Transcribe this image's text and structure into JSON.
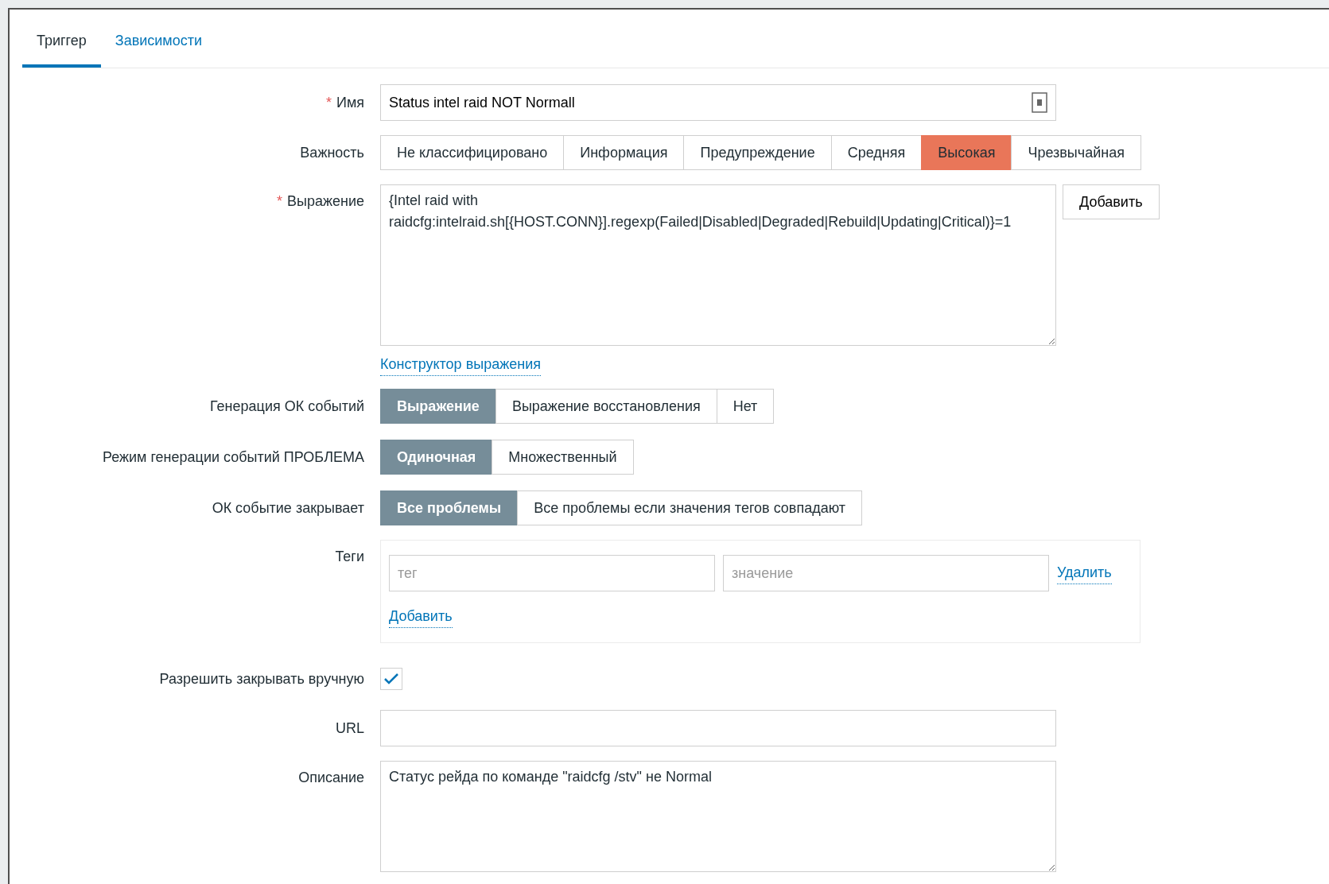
{
  "tabs": [
    {
      "label": "Триггер",
      "selected": true
    },
    {
      "label": "Зависимости",
      "selected": false
    }
  ],
  "name": {
    "label": "Имя",
    "required_mark": "*",
    "value": "Status intel raid NOT Normall"
  },
  "severity": {
    "label": "Важность",
    "options": [
      {
        "label": "Не классифицировано",
        "selected": false
      },
      {
        "label": "Информация",
        "selected": false
      },
      {
        "label": "Предупреждение",
        "selected": false
      },
      {
        "label": "Средняя",
        "selected": false
      },
      {
        "label": "Высокая",
        "selected": true,
        "color": "#e97659"
      },
      {
        "label": "Чрезвычайная",
        "selected": false
      }
    ]
  },
  "expression": {
    "label": "Выражение",
    "required_mark": "*",
    "value": "{Intel raid with raidcfg:intelraid.sh[{HOST.CONN}].regexp(Failed|Disabled|Degraded|Rebuild|Updating|Critical)}=1",
    "add_button": "Добавить",
    "constructor_link": "Конструктор выражения"
  },
  "segmented": [
    {
      "label": "Генерация ОК событий",
      "options": [
        {
          "label": "Выражение",
          "selected": true
        },
        {
          "label": "Выражение восстановления",
          "selected": false
        },
        {
          "label": "Нет",
          "selected": false
        }
      ]
    },
    {
      "label": "Режим генерации событий ПРОБЛЕМА",
      "options": [
        {
          "label": "Одиночная",
          "selected": true
        },
        {
          "label": "Множественный",
          "selected": false
        }
      ]
    },
    {
      "label": "ОК событие закрывает",
      "options": [
        {
          "label": "Все проблемы",
          "selected": true
        },
        {
          "label": "Все проблемы если значения тегов совпадают",
          "selected": false
        }
      ]
    }
  ],
  "tags": {
    "label": "Теги",
    "rows": [
      {
        "tag_placeholder": "тег",
        "value_placeholder": "значение",
        "remove_link": "Удалить"
      }
    ],
    "add_link": "Добавить"
  },
  "manual_close": {
    "label": "Разрешить закрывать вручную",
    "checked": true
  },
  "url": {
    "label": "URL"
  },
  "description": {
    "label": "Описание",
    "value": "Статус рейда по команде \"raidcfg /stv\" не Normal"
  }
}
